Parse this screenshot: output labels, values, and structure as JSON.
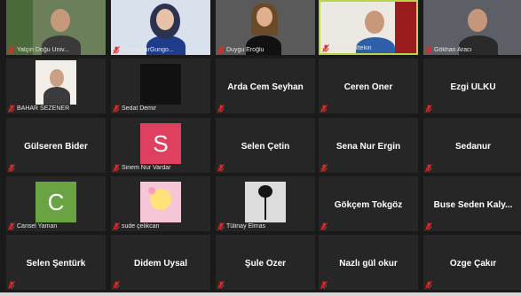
{
  "colors": {
    "background": "#1a1a1a",
    "tile": "#262626",
    "active_speaker_border": "#b8d44a",
    "muted_icon": "#e02b2b",
    "avatar_pink": "#e0405f",
    "avatar_green": "#6aa342"
  },
  "participants": [
    {
      "name": "Yalçın Doğu Üniv...",
      "kind": "video"
    },
    {
      "name": "SeymanurGungo...",
      "kind": "video"
    },
    {
      "name": "Duygu Eroğlu",
      "kind": "video"
    },
    {
      "name": "Sadık Gültekin",
      "kind": "video",
      "active": true
    },
    {
      "name": "Gökhan Aracı",
      "kind": "video"
    },
    {
      "name": "BAHAR SEZENER",
      "kind": "photo"
    },
    {
      "name": "Sedat Demir",
      "kind": "photo-dark"
    },
    {
      "name": "Arda Cem Seyhan",
      "kind": "name"
    },
    {
      "name": "Ceren Öner",
      "kind": "name"
    },
    {
      "name": "Ezgi ÜLKÜ",
      "kind": "name"
    },
    {
      "name": "Gülseren Bider",
      "kind": "name"
    },
    {
      "name": "Sinem Nur Vardar",
      "kind": "letter",
      "letter": "S"
    },
    {
      "name": "Selen Çetin",
      "kind": "name"
    },
    {
      "name": "Sena Nur Ergin",
      "kind": "name"
    },
    {
      "name": "Sedanur",
      "kind": "name"
    },
    {
      "name": "Cansel Yaman",
      "kind": "letter",
      "letter": "C"
    },
    {
      "name": "sude çelikcan",
      "kind": "sticker"
    },
    {
      "name": "Tülinay Elmas",
      "kind": "rose"
    },
    {
      "name": "Gökçem Tokgöz",
      "kind": "name"
    },
    {
      "name": "Buse Seden Kaly...",
      "kind": "name"
    },
    {
      "name": "Selen Şentürk",
      "kind": "name"
    },
    {
      "name": "Didem Uysal",
      "kind": "name"
    },
    {
      "name": "Şule Özer",
      "kind": "name"
    },
    {
      "name": "Nazlı gül okur",
      "kind": "name"
    },
    {
      "name": "Özge Çakır",
      "kind": "name"
    }
  ]
}
